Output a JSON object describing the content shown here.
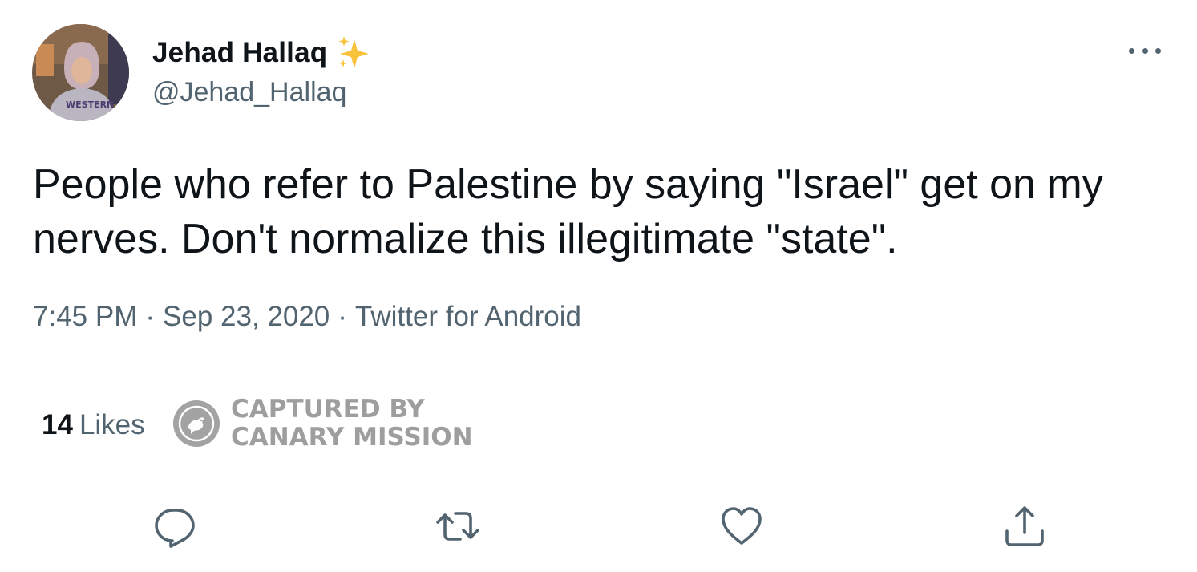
{
  "tweet": {
    "author": {
      "display_name": "Jehad Hallaq",
      "badge_icon": "sparkles-icon",
      "handle": "@Jehad_Hallaq",
      "avatar_icon": "profile-photo"
    },
    "more_icon": "more-icon",
    "text": "People who refer to Palestine by saying \"Israel\" get on my nerves. Don't normalize this illegitimate \"state\".",
    "time": "7:45 PM",
    "separator": "·",
    "date": "Sep 23, 2020",
    "source": "Twitter for Android",
    "stats": {
      "likes_count": "14",
      "likes_label": "Likes"
    },
    "watermark": {
      "line1": "CAPTURED BY",
      "line2": "CANARY MISSION",
      "color": "#9e9e9e"
    },
    "actions": {
      "reply_icon": "reply-icon",
      "retweet_icon": "retweet-icon",
      "like_icon": "heart-icon",
      "share_icon": "share-icon"
    },
    "colors": {
      "text_primary": "#0f1419",
      "text_secondary": "#536471",
      "divider": "#e1e6ea",
      "sparkle": "#f8c33b"
    }
  }
}
